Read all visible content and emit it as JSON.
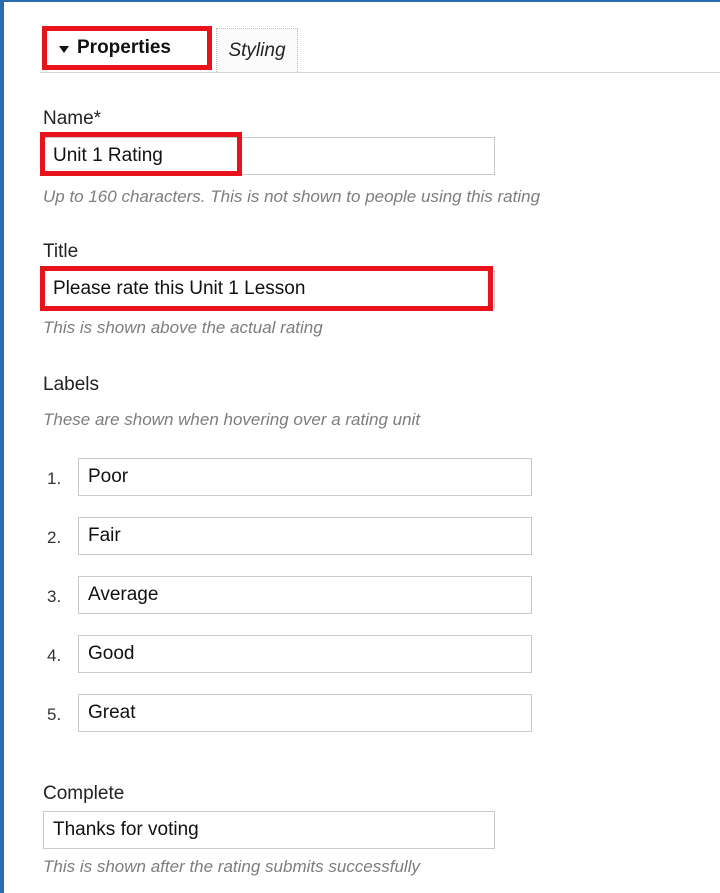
{
  "tabs": {
    "properties": "Properties",
    "styling": "Styling"
  },
  "name": {
    "label": "Name*",
    "value": "Unit 1 Rating",
    "hint": "Up to 160 characters. This is not shown to people using this rating"
  },
  "title": {
    "label": "Title",
    "value": "Please rate this Unit 1 Lesson",
    "hint": "This is shown above the actual rating"
  },
  "labels": {
    "heading": "Labels",
    "hint": "These are shown when hovering over a rating unit",
    "items": [
      {
        "number": "1.",
        "value": "Poor"
      },
      {
        "number": "2.",
        "value": "Fair"
      },
      {
        "number": "3.",
        "value": "Average"
      },
      {
        "number": "4.",
        "value": "Good"
      },
      {
        "number": "5.",
        "value": "Great"
      }
    ]
  },
  "complete": {
    "label": "Complete",
    "value": "Thanks for voting",
    "hint": "This is shown after the rating submits successfully"
  },
  "colors": {
    "highlight": "#e8121a",
    "frame": "#2b6cb0"
  }
}
